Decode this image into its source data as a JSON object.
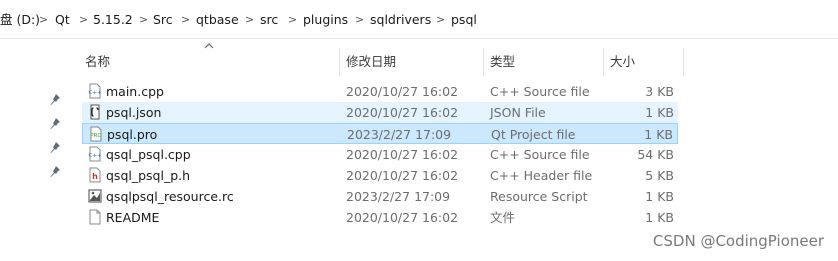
{
  "address_bar": {
    "crumbs": [
      "盘 (D:)",
      "Qt",
      "5.15.2",
      "Src",
      "qtbase",
      "src",
      "plugins",
      "sqldrivers",
      "psql"
    ],
    "separator": ">"
  },
  "columns": {
    "name": "名称",
    "modified": "修改日期",
    "type": "类型",
    "size": "大小"
  },
  "files": [
    {
      "name": "main.cpp",
      "modified": "2020/10/27 16:02",
      "type": "C++ Source file",
      "size": "3 KB",
      "icon": "cpp-file-icon"
    },
    {
      "name": "psql.json",
      "modified": "2020/10/27 16:02",
      "type": "JSON File",
      "size": "1 KB",
      "icon": "json-file-icon"
    },
    {
      "name": "psql.pro",
      "modified": "2023/2/27 17:09",
      "type": "Qt Project file",
      "size": "1 KB",
      "icon": "qt-project-file-icon"
    },
    {
      "name": "qsql_psql.cpp",
      "modified": "2020/10/27 16:02",
      "type": "C++ Source file",
      "size": "54 KB",
      "icon": "cpp-file-icon"
    },
    {
      "name": "qsql_psql_p.h",
      "modified": "2020/10/27 16:02",
      "type": "C++ Header file",
      "size": "5 KB",
      "icon": "header-file-icon"
    },
    {
      "name": "qsqlpsql_resource.rc",
      "modified": "2023/2/27 17:09",
      "type": "Resource Script",
      "size": "1 KB",
      "icon": "resource-script-icon"
    },
    {
      "name": "README",
      "modified": "2020/10/27 16:02",
      "type": "文件",
      "size": "1 KB",
      "icon": "generic-file-icon"
    }
  ],
  "watermark": "CSDN @CodingPioneer",
  "colors": {
    "hover_row": "#e5f3ff",
    "selected_row": "#cce8ff",
    "selected_border": "#99d1ff"
  }
}
